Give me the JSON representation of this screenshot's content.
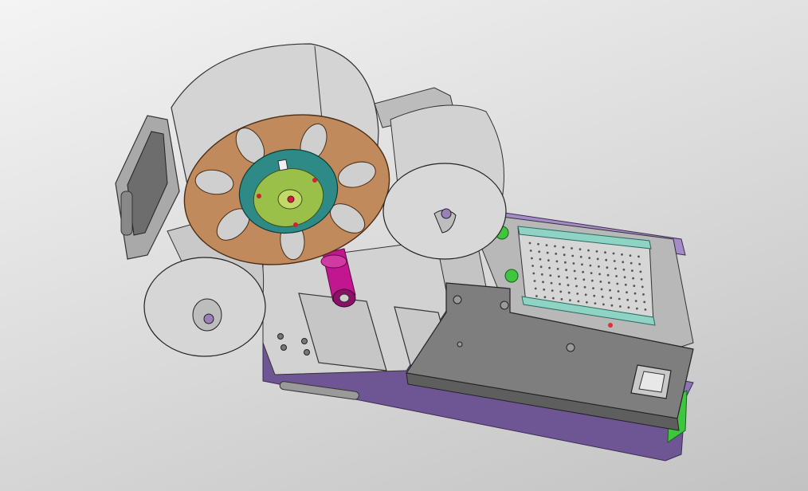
{
  "viewport": {
    "background_top": "#f4f4f4",
    "background_bottom": "#c2c2c2"
  },
  "model": {
    "description_icon": "cad-3d-assembly-icon",
    "colors": {
      "base_plate": "#8f74b3",
      "base_plate_dark": "#6e5694",
      "chassis": "#d2d2d2",
      "chassis_dark": "#8e8e8e",
      "top_plate": "#7e7e7e",
      "spool_body": "#d6d6d6",
      "spool_face": "#cfcfcf",
      "reel_wheel": "#c08a5c",
      "hub_ring": "#2e8a86",
      "hub_center": "#9ac04a",
      "magenta_shaft": "#c1168f",
      "green_part": "#3ec63e",
      "teal_rail": "#8fd3c4",
      "red_marker": "#e0303a"
    }
  }
}
